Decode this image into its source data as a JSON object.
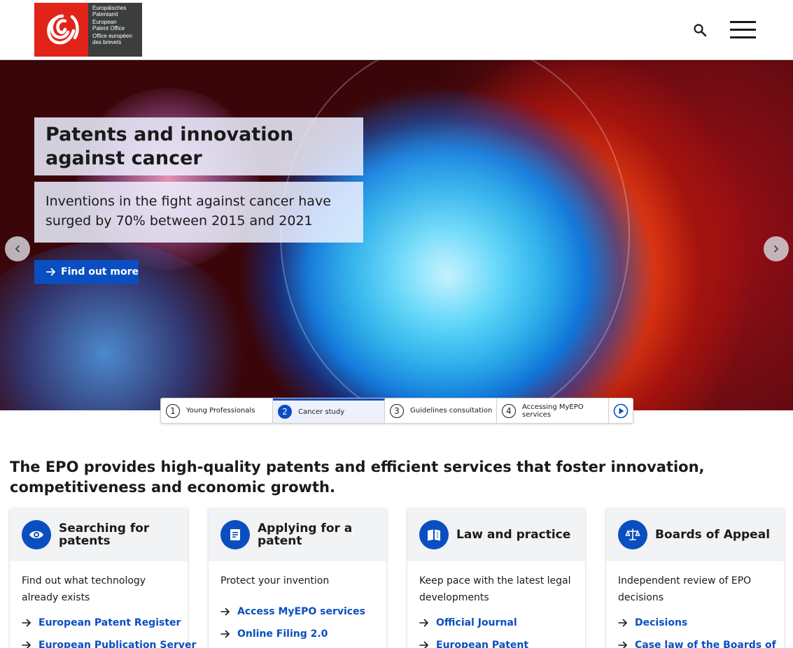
{
  "header": {
    "logo_lines": [
      "Europäisches",
      "Patentamt",
      "European",
      "Patent Office",
      "Office européen",
      "des brevets"
    ],
    "search_icon": "search-icon",
    "menu_icon": "hamburger-menu-icon"
  },
  "hero": {
    "title": "Patents and innovation against cancer",
    "subtitle": "Inventions in the fight against cancer have surged by 70% between 2015 and 2021",
    "cta_label": "Find out more",
    "prev_icon": "chevron-left-icon",
    "next_icon": "chevron-right-icon"
  },
  "slides": [
    {
      "number": "1",
      "label": "Young Professionals"
    },
    {
      "number": "2",
      "label": "Cancer study"
    },
    {
      "number": "3",
      "label": "Guidelines consultation"
    },
    {
      "number": "4",
      "label": "Accessing MyEPO services"
    }
  ],
  "slides_play_icon": "play-icon",
  "intro": "The EPO provides high-quality patents and efficient services that foster innovation, competitiveness and economic growth.",
  "cards": [
    {
      "title": "Searching for patents",
      "icon": "eye-icon",
      "description": "Find out what technology already exists",
      "links": [
        "European Patent Register",
        "European Publication Server"
      ]
    },
    {
      "title": "Applying for a patent",
      "icon": "document-icon",
      "description": "Protect your invention",
      "links": [
        "Access MyEPO services",
        "Online Filing 2.0"
      ]
    },
    {
      "title": "Law and practice",
      "icon": "open-book-icon",
      "description": "Keep pace with the latest legal developments",
      "links": [
        "Official Journal",
        "European Patent"
      ]
    },
    {
      "title": "Boards of Appeal",
      "icon": "scales-icon",
      "description": "Independent review of EPO decisions",
      "links": [
        "Decisions",
        "Case law of the Boards of"
      ]
    }
  ],
  "colors": {
    "accent": "#0a4fc1",
    "logo_red": "#e2231a",
    "logo_dark": "#3b3d3f"
  }
}
